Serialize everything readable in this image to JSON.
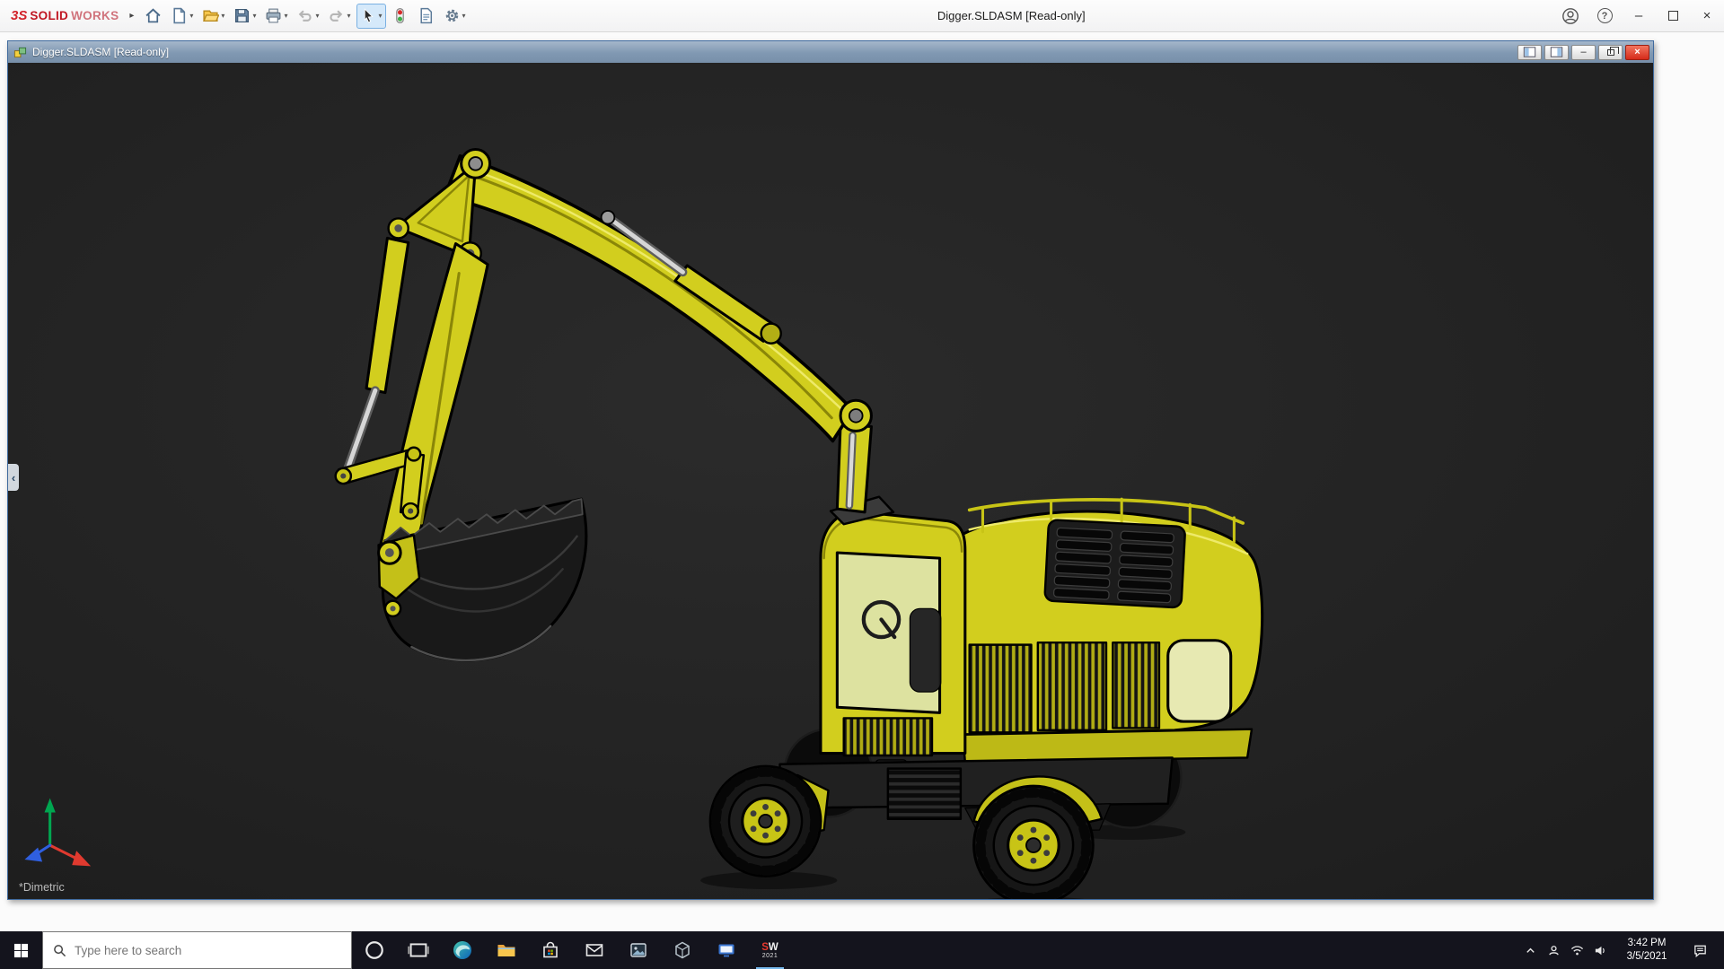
{
  "colors": {
    "solidworks_red": "#d2232a",
    "model_yellow": "#d2ce1e",
    "selection_blue": "#d5e9fa",
    "doc_titlebar_blue": "#8098b2",
    "taskbar_bg": "#14141d",
    "viewport_bg": "#232323",
    "taskbar_indicator_blue": "#76b9ed"
  },
  "app": {
    "brand_logo": "3S",
    "brand_name_bold": "SOLID",
    "brand_name_light": "WORKS",
    "title": "Digger.SLDASM [Read-only]",
    "toolbar_icons": [
      "home",
      "new-document",
      "open",
      "save",
      "print",
      "undo",
      "redo",
      "select",
      "rebuild",
      "file-properties",
      "options"
    ]
  },
  "doc": {
    "title": "Digger.SLDASM [Read-only]",
    "view_label": "*Dimetric"
  },
  "glyphs": {
    "flyout": "▸",
    "dropdown": "▾",
    "help": "?",
    "minimize": "–",
    "close": "×",
    "panel_collapse": "‹"
  },
  "taskbar": {
    "search_placeholder": "Type here to search",
    "pinned_apps": [
      "start",
      "search",
      "cortana",
      "task-view",
      "edge",
      "file-explorer",
      "microsoft-store",
      "mail",
      "photos",
      "3d-viewer",
      "movies-tv",
      "solidworks-2021"
    ],
    "solidworks_s": "S",
    "solidworks_w": "W",
    "solidworks_year": "2021",
    "tray_icons": [
      "hidden-icons",
      "people",
      "network",
      "volume",
      "action-center"
    ],
    "clock_time": "3:42 PM",
    "clock_date": "3/5/2021"
  }
}
